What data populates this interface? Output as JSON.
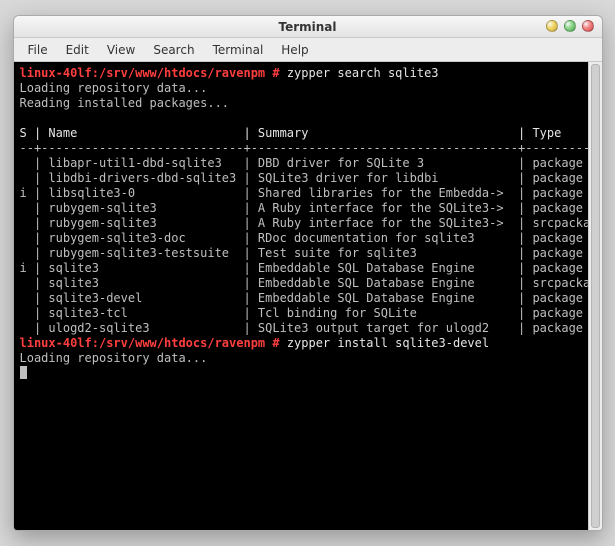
{
  "window": {
    "title": "Terminal"
  },
  "menubar": {
    "items": [
      "File",
      "Edit",
      "View",
      "Search",
      "Terminal",
      "Help"
    ]
  },
  "prompt1": {
    "path": "linux-40lf:/srv/www/htdocs/ravenpm #",
    "cmd": "zypper search sqlite3"
  },
  "loading1": "Loading repository data...",
  "reading": "Reading installed packages...",
  "table": {
    "headers": {
      "s": "S",
      "name": "Name",
      "summary": "Summary",
      "type": "Type"
    },
    "rows": [
      {
        "s": " ",
        "name": "libapr-util1-dbd-sqlite3",
        "summary": "DBD driver for SQLite 3",
        "type": "package"
      },
      {
        "s": " ",
        "name": "libdbi-drivers-dbd-sqlite3",
        "summary": "SQLite3 driver for libdbi",
        "type": "package"
      },
      {
        "s": "i",
        "name": "libsqlite3-0",
        "summary": "Shared libraries for the Embedda->",
        "type": "package"
      },
      {
        "s": " ",
        "name": "rubygem-sqlite3",
        "summary": "A Ruby interface for the SQLite3->",
        "type": "package"
      },
      {
        "s": " ",
        "name": "rubygem-sqlite3",
        "summary": "A Ruby interface for the SQLite3->",
        "type": "srcpackage"
      },
      {
        "s": " ",
        "name": "rubygem-sqlite3-doc",
        "summary": "RDoc documentation for sqlite3",
        "type": "package"
      },
      {
        "s": " ",
        "name": "rubygem-sqlite3-testsuite",
        "summary": "Test suite for sqlite3",
        "type": "package"
      },
      {
        "s": "i",
        "name": "sqlite3",
        "summary": "Embeddable SQL Database Engine",
        "type": "package"
      },
      {
        "s": " ",
        "name": "sqlite3",
        "summary": "Embeddable SQL Database Engine",
        "type": "srcpackage"
      },
      {
        "s": " ",
        "name": "sqlite3-devel",
        "summary": "Embeddable SQL Database Engine",
        "type": "package"
      },
      {
        "s": " ",
        "name": "sqlite3-tcl",
        "summary": "Tcl binding for SQLite",
        "type": "package"
      },
      {
        "s": " ",
        "name": "ulogd2-sqlite3",
        "summary": "SQLite3 output target for ulogd2",
        "type": "package"
      }
    ]
  },
  "prompt2": {
    "path": "linux-40lf:/srv/www/htdocs/ravenpm #",
    "cmd": "zypper install sqlite3-devel"
  },
  "loading2": "Loading repository data..."
}
